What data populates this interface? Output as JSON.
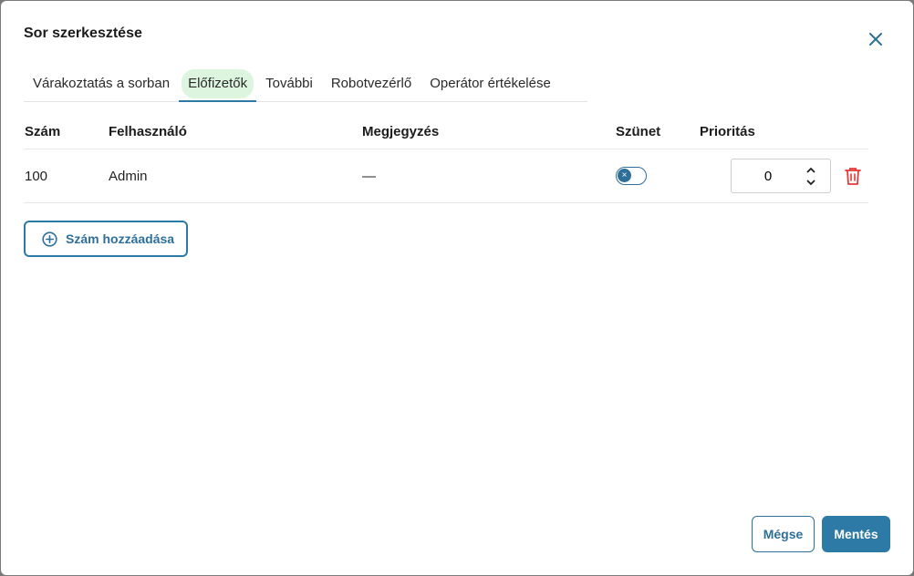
{
  "dialog": {
    "title": "Sor szerkesztése",
    "close_icon": "close-icon"
  },
  "tabs": [
    {
      "label": "Várakoztatás a sorban",
      "active": false
    },
    {
      "label": "Előfizetők",
      "active": true
    },
    {
      "label": "További",
      "active": false
    },
    {
      "label": "Robotvezérlő",
      "active": false
    },
    {
      "label": "Operátor értékelése",
      "active": false
    }
  ],
  "table": {
    "headers": {
      "number": "Szám",
      "user": "Felhasználó",
      "note": "Megjegyzés",
      "pause": "Szünet",
      "priority": "Prioritás"
    },
    "rows": [
      {
        "number": "100",
        "user": "Admin",
        "note": "—",
        "pause": false,
        "priority": "0",
        "delete_icon": "trash-icon"
      }
    ]
  },
  "add_button": {
    "label": "Szám hozzáadása",
    "icon": "plus-circle-icon"
  },
  "footer": {
    "cancel_label": "Mégse",
    "save_label": "Mentés"
  },
  "colors": {
    "accent": "#2e7aa6",
    "active_tab_bg": "#ddf5df",
    "delete": "#e53935"
  }
}
